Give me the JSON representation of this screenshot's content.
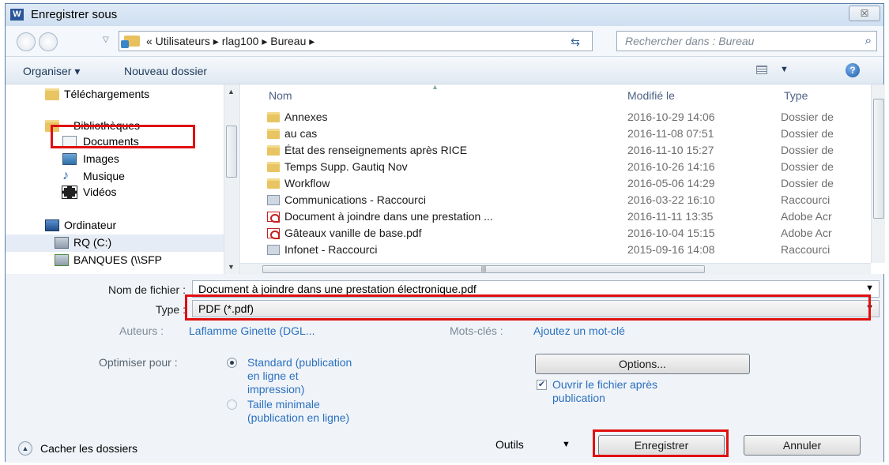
{
  "window": {
    "title": "Enregistrer sous",
    "app_icon_text": "W",
    "close_label": "☒"
  },
  "address": {
    "breadcrumb": "« Utilisateurs ▸ rlag100 ▸ Bureau ▸",
    "search_placeholder": "Rechercher dans : Bureau"
  },
  "toolbar": {
    "organize": "Organiser ▾",
    "new_folder": "Nouveau dossier",
    "help": "?"
  },
  "nav": {
    "items": [
      {
        "label": "Téléchargements",
        "icon": "download-folder-icon"
      },
      {
        "label": "Bibliothèques",
        "icon": "libraries-icon"
      },
      {
        "label": "Documents",
        "icon": "documents-icon"
      },
      {
        "label": "Images",
        "icon": "images-icon"
      },
      {
        "label": "Musique",
        "icon": "music-icon"
      },
      {
        "label": "Vidéos",
        "icon": "videos-icon"
      },
      {
        "label": "Ordinateur",
        "icon": "computer-icon"
      },
      {
        "label": "RQ (C:)",
        "icon": "drive-icon"
      },
      {
        "label": "BANQUES (\\\\SFP",
        "icon": "network-drive-icon"
      }
    ]
  },
  "files": {
    "columns": {
      "name": "Nom",
      "modified": "Modifié le",
      "type": "Type"
    },
    "rows": [
      {
        "name": "Annexes",
        "date": "2016-10-29 14:06",
        "type": "Dossier de",
        "icon": "folder"
      },
      {
        "name": "au cas",
        "date": "2016-11-08 07:51",
        "type": "Dossier de",
        "icon": "folder"
      },
      {
        "name": "État des renseignements après RICE",
        "date": "2016-11-10 15:27",
        "type": "Dossier de",
        "icon": "folder"
      },
      {
        "name": "Temps Supp. Gautiq Nov",
        "date": "2016-10-26 14:16",
        "type": "Dossier de",
        "icon": "folder"
      },
      {
        "name": "Workflow",
        "date": "2016-05-06 14:29",
        "type": "Dossier de",
        "icon": "folder"
      },
      {
        "name": "Communications - Raccourci",
        "date": "2016-03-22 16:10",
        "type": "Raccourci",
        "icon": "shortcut"
      },
      {
        "name": "Document à joindre dans une prestation ...",
        "date": "2016-11-11 13:35",
        "type": "Adobe Acr",
        "icon": "pdf"
      },
      {
        "name": "Gâteaux vanille de base.pdf",
        "date": "2016-10-04 15:15",
        "type": "Adobe Acr",
        "icon": "pdf"
      },
      {
        "name": "Infonet - Raccourci",
        "date": "2015-09-16 14:08",
        "type": "Raccourci",
        "icon": "shortcut"
      }
    ]
  },
  "form": {
    "filename_label": "Nom de fichier :",
    "filename_value": "Document à joindre dans une prestation électronique.pdf",
    "type_label": "Type :",
    "type_value": "PDF (*.pdf)",
    "authors_label": "Auteurs :",
    "authors_value": "Laflamme Ginette (DGL...",
    "keywords_label": "Mots-clés :",
    "keywords_value": "Ajoutez un mot-clé",
    "optimize_label": "Optimiser pour :",
    "opt_standard_l1": "Standard (publication",
    "opt_standard_l2": "en ligne et",
    "opt_standard_l3": "impression)",
    "opt_min_l1": "Taille minimale",
    "opt_min_l2": "(publication en ligne)",
    "options_button": "Options...",
    "open_after_l1": "Ouvrir le fichier après",
    "open_after_l2": "publication",
    "open_after_checked": true
  },
  "footer": {
    "hide_folders": "Cacher les dossiers",
    "tools": "Outils",
    "save": "Enregistrer",
    "cancel": "Annuler"
  },
  "colors": {
    "highlight": "#e01010",
    "link": "#2a6fc0"
  }
}
